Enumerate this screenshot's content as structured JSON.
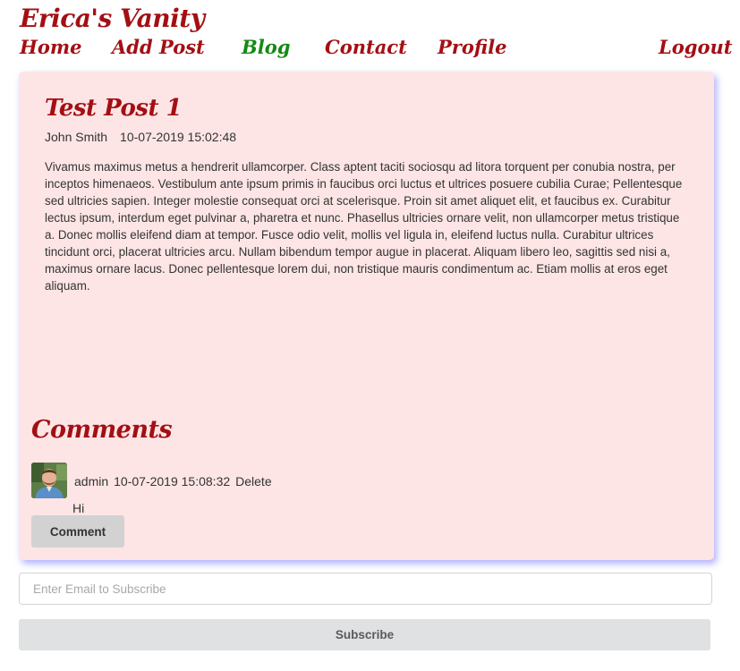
{
  "brand": "Erica's Vanity",
  "nav": {
    "home": "Home",
    "add_post": "Add Post",
    "blog": "Blog",
    "contact": "Contact",
    "profile": "Profile",
    "logout": "Logout",
    "active": "Blog"
  },
  "post": {
    "title": "Test Post 1",
    "author": "John Smith",
    "timestamp": "10-07-2019 15:02:48",
    "body": "Vivamus maximus metus a hendrerit ullamcorper. Class aptent taciti sociosqu ad litora torquent per conubia nostra, per inceptos himenaeos. Vestibulum ante ipsum primis in faucibus orci luctus et ultrices posuere cubilia Curae; Pellentesque sed ultricies sapien. Integer molestie consequat orci at scelerisque. Proin sit amet aliquet elit, et faucibus ex. Curabitur lectus ipsum, interdum eget pulvinar a, pharetra et nunc. Phasellus ultricies ornare velit, non ullamcorper metus tristique a. Donec mollis eleifend diam at tempor. Fusce odio velit, mollis vel ligula in, eleifend luctus nulla. Curabitur ultrices tincidunt orci, placerat ultricies arcu. Nullam bibendum tempor augue in placerat. Aliquam libero leo, sagittis sed nisi a, maximus ornare lacus. Donec pellentesque lorem dui, non tristique mauris condimentum ac. Etiam mollis at eros eget aliquam."
  },
  "comments": {
    "heading": "Comments",
    "items": [
      {
        "user": "admin",
        "timestamp": "10-07-2019 15:08:32",
        "delete_label": "Delete",
        "text": "Hi"
      }
    ],
    "comment_button": "Comment"
  },
  "subscribe": {
    "placeholder": "Enter Email to Subscribe",
    "value": "",
    "button": "Subscribe"
  },
  "colors": {
    "brand": "#a30f14",
    "active_nav": "#148a14",
    "card_background": "#fde5e5",
    "card_shadow": "#9696ff"
  }
}
